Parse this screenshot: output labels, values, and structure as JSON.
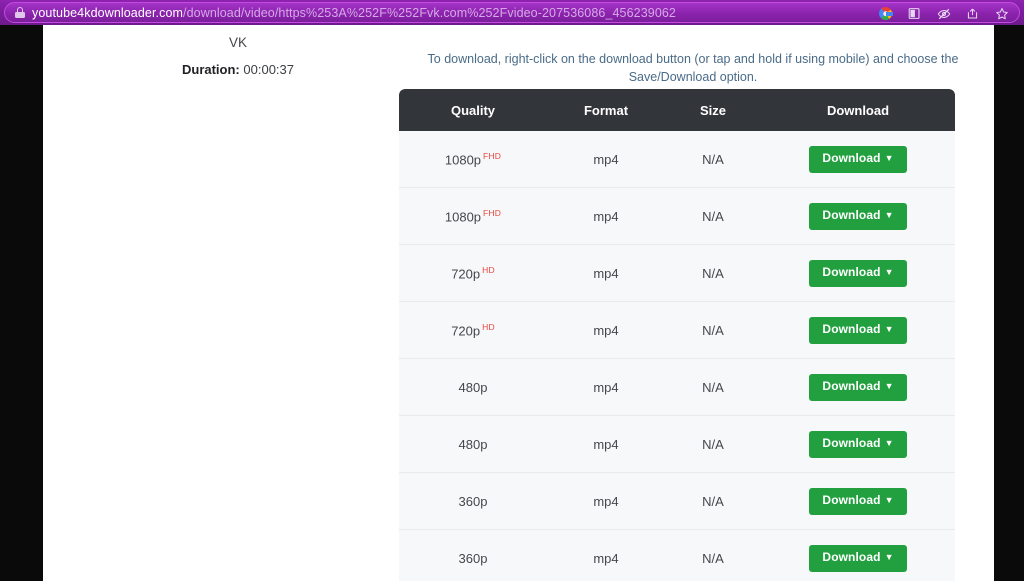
{
  "browser": {
    "url_domain": "youtube4kdownloader.com",
    "url_path": "/download/video/https%253A%252F%252Fvk.com%252Fvideo-207536086_456239062",
    "lock_icon": "lock-icon",
    "toolbar_icons": [
      {
        "name": "google-icon",
        "glyph": "G"
      },
      {
        "name": "office-icon",
        "glyph": "▧"
      },
      {
        "name": "eye-slash-icon",
        "glyph": "⌽"
      },
      {
        "name": "share-icon",
        "glyph": "↪"
      },
      {
        "name": "bookmark-star-icon",
        "glyph": "☆"
      }
    ]
  },
  "video_info": {
    "site": "VK",
    "duration_label": "Duration:",
    "duration_value": "00:00:37"
  },
  "main": {
    "hint": "To download, right-click on the download button (or tap and hold if using mobile) and choose the Save/Download option."
  },
  "table": {
    "headers": [
      "Quality",
      "Format",
      "Size",
      "Download"
    ],
    "download_label": "Download",
    "caret": "▼",
    "accent_green": "#22a03f",
    "header_bg": "#32363b",
    "badge_color": "#e8473f",
    "rows": [
      {
        "quality": "1080p",
        "badge": "FHD",
        "format": "mp4",
        "size": "N/A",
        "action": "Download"
      },
      {
        "quality": "1080p",
        "badge": "FHD",
        "format": "mp4",
        "size": "N/A",
        "action": "Download"
      },
      {
        "quality": "720p",
        "badge": "HD",
        "format": "mp4",
        "size": "N/A",
        "action": "Download"
      },
      {
        "quality": "720p",
        "badge": "HD",
        "format": "mp4",
        "size": "N/A",
        "action": "Download"
      },
      {
        "quality": "480p",
        "badge": "",
        "format": "mp4",
        "size": "N/A",
        "action": "Download"
      },
      {
        "quality": "480p",
        "badge": "",
        "format": "mp4",
        "size": "N/A",
        "action": "Download"
      },
      {
        "quality": "360p",
        "badge": "",
        "format": "mp4",
        "size": "N/A",
        "action": "Download"
      },
      {
        "quality": "360p",
        "badge": "",
        "format": "mp4",
        "size": "N/A",
        "action": "Download"
      }
    ]
  }
}
